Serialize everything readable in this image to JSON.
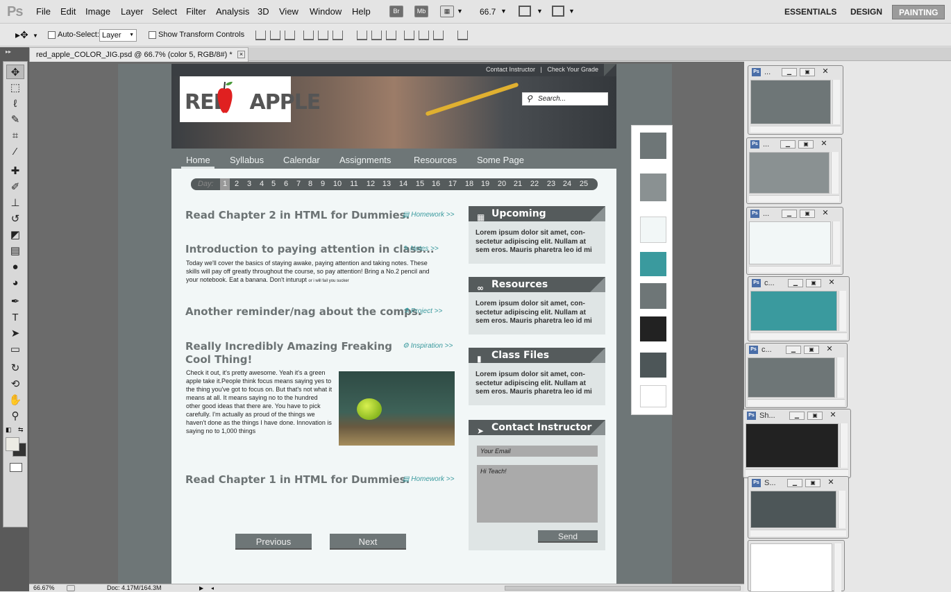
{
  "app": {
    "logo": "Ps",
    "menu": [
      "File",
      "Edit",
      "Image",
      "Layer",
      "Select",
      "Filter",
      "Analysis",
      "3D",
      "View",
      "Window",
      "Help"
    ],
    "mini_buttons": [
      "Br",
      "Mb"
    ],
    "zoom_value": "66.7",
    "workspaces": [
      "ESSENTIALS",
      "DESIGN",
      "PAINTING"
    ],
    "active_workspace": "PAINTING"
  },
  "options_bar": {
    "auto_select_label": "Auto-Select:",
    "auto_select_value": "Layer",
    "transform_label": "Show Transform Controls"
  },
  "document": {
    "tab_title": "red_apple_COLOR_JIG.psd @ 66.7% (color 5, RGB/8#) *",
    "close": "×"
  },
  "site": {
    "top_links": [
      "Contact Instructor",
      "Check Your Grade"
    ],
    "logo_text": [
      "RED",
      "APPLE"
    ],
    "search_placeholder": "Search...",
    "nav": [
      "Home",
      "Syllabus",
      "Calendar",
      "Assignments",
      "Resources",
      "Some Page"
    ],
    "day_label": "Day:",
    "days": [
      "1",
      "2",
      "3",
      "4",
      "5",
      "6",
      "7",
      "8",
      "9",
      "10",
      "11",
      "12",
      "13",
      "14",
      "15",
      "16",
      "17",
      "18",
      "19",
      "20",
      "21",
      "22",
      "23",
      "24",
      "25"
    ],
    "posts": [
      {
        "title": "Read Chapter 2 in HTML for Dummies.",
        "link": "Homework >>"
      },
      {
        "title": "Introduction to paying attention in class...",
        "link": "Notes >>",
        "body": "Today we'll cover the basics of staying awake, paying attention and taking notes. These skills will pay off greatly throughout the course, so pay attention! Bring a No.2 pencil and your notebook. Eat a banana. Don't inturupt",
        "tiny": "or i will fail you sucker"
      },
      {
        "title": "Another reminder/nag about the comps.",
        "link": "Project >>"
      },
      {
        "title_line1": "Really Incredibly Amazing Freaking",
        "title_line2": "Cool Thing!",
        "link": "Inspiration >>",
        "body": "Check it out, it's pretty awesome. Yeah it's a green apple take it.People think focus means saying yes to the thing you've got to focus on. But that's not what it means at all. It means saying no to the hundred other good ideas that there are. You have to pick carefully. I'm actually as proud of the things we haven't done as the things I have done. Innovation is saying no to 1,000 things"
      },
      {
        "title": "Read Chapter 1 in HTML for Dummies.",
        "link": "Homework >>"
      }
    ],
    "pager": [
      "Previous",
      "Next"
    ],
    "widgets": [
      {
        "title": "Upcoming",
        "body": "Lorem ipsum dolor sit amet, con-sectetur adipiscing elit. Nullam at sem eros. Mauris pharetra leo id mi"
      },
      {
        "title": "Resources",
        "body": "Lorem ipsum dolor sit amet, con-sectetur adipiscing elit. Nullam at sem eros. Mauris pharetra leo id mi"
      },
      {
        "title": "Class Files",
        "body": "Lorem ipsum dolor sit amet, con-sectetur adipiscing elit. Nullam at sem eros. Mauris pharetra leo id mi"
      },
      {
        "title": "Contact Instructor"
      }
    ],
    "contact": {
      "email_placeholder": "Your Email",
      "message_value": "Hi Teach!",
      "send": "Send"
    }
  },
  "swatches": [
    "#6e7677",
    "#8a9192",
    "#f2f7f7",
    "#3a9a9e",
    "#6e7677",
    "#222222",
    "#4d5658",
    "#ffffff"
  ],
  "windows": [
    {
      "title": "...",
      "color": "#6e7677"
    },
    {
      "title": "...",
      "color": "#8a9192"
    },
    {
      "title": "...",
      "color": "#f2f7f7"
    },
    {
      "title": "c...",
      "color": "#3a9a9e"
    },
    {
      "title": "c...",
      "color": "#6e7677"
    },
    {
      "title": "Sh...",
      "color": "#222222"
    },
    {
      "title": "S...",
      "color": "#4d5658"
    },
    {
      "title": "",
      "color": "#ffffff"
    }
  ],
  "status": {
    "zoom": "66.67%",
    "doc": "Doc: 4.17M/164.3M"
  }
}
